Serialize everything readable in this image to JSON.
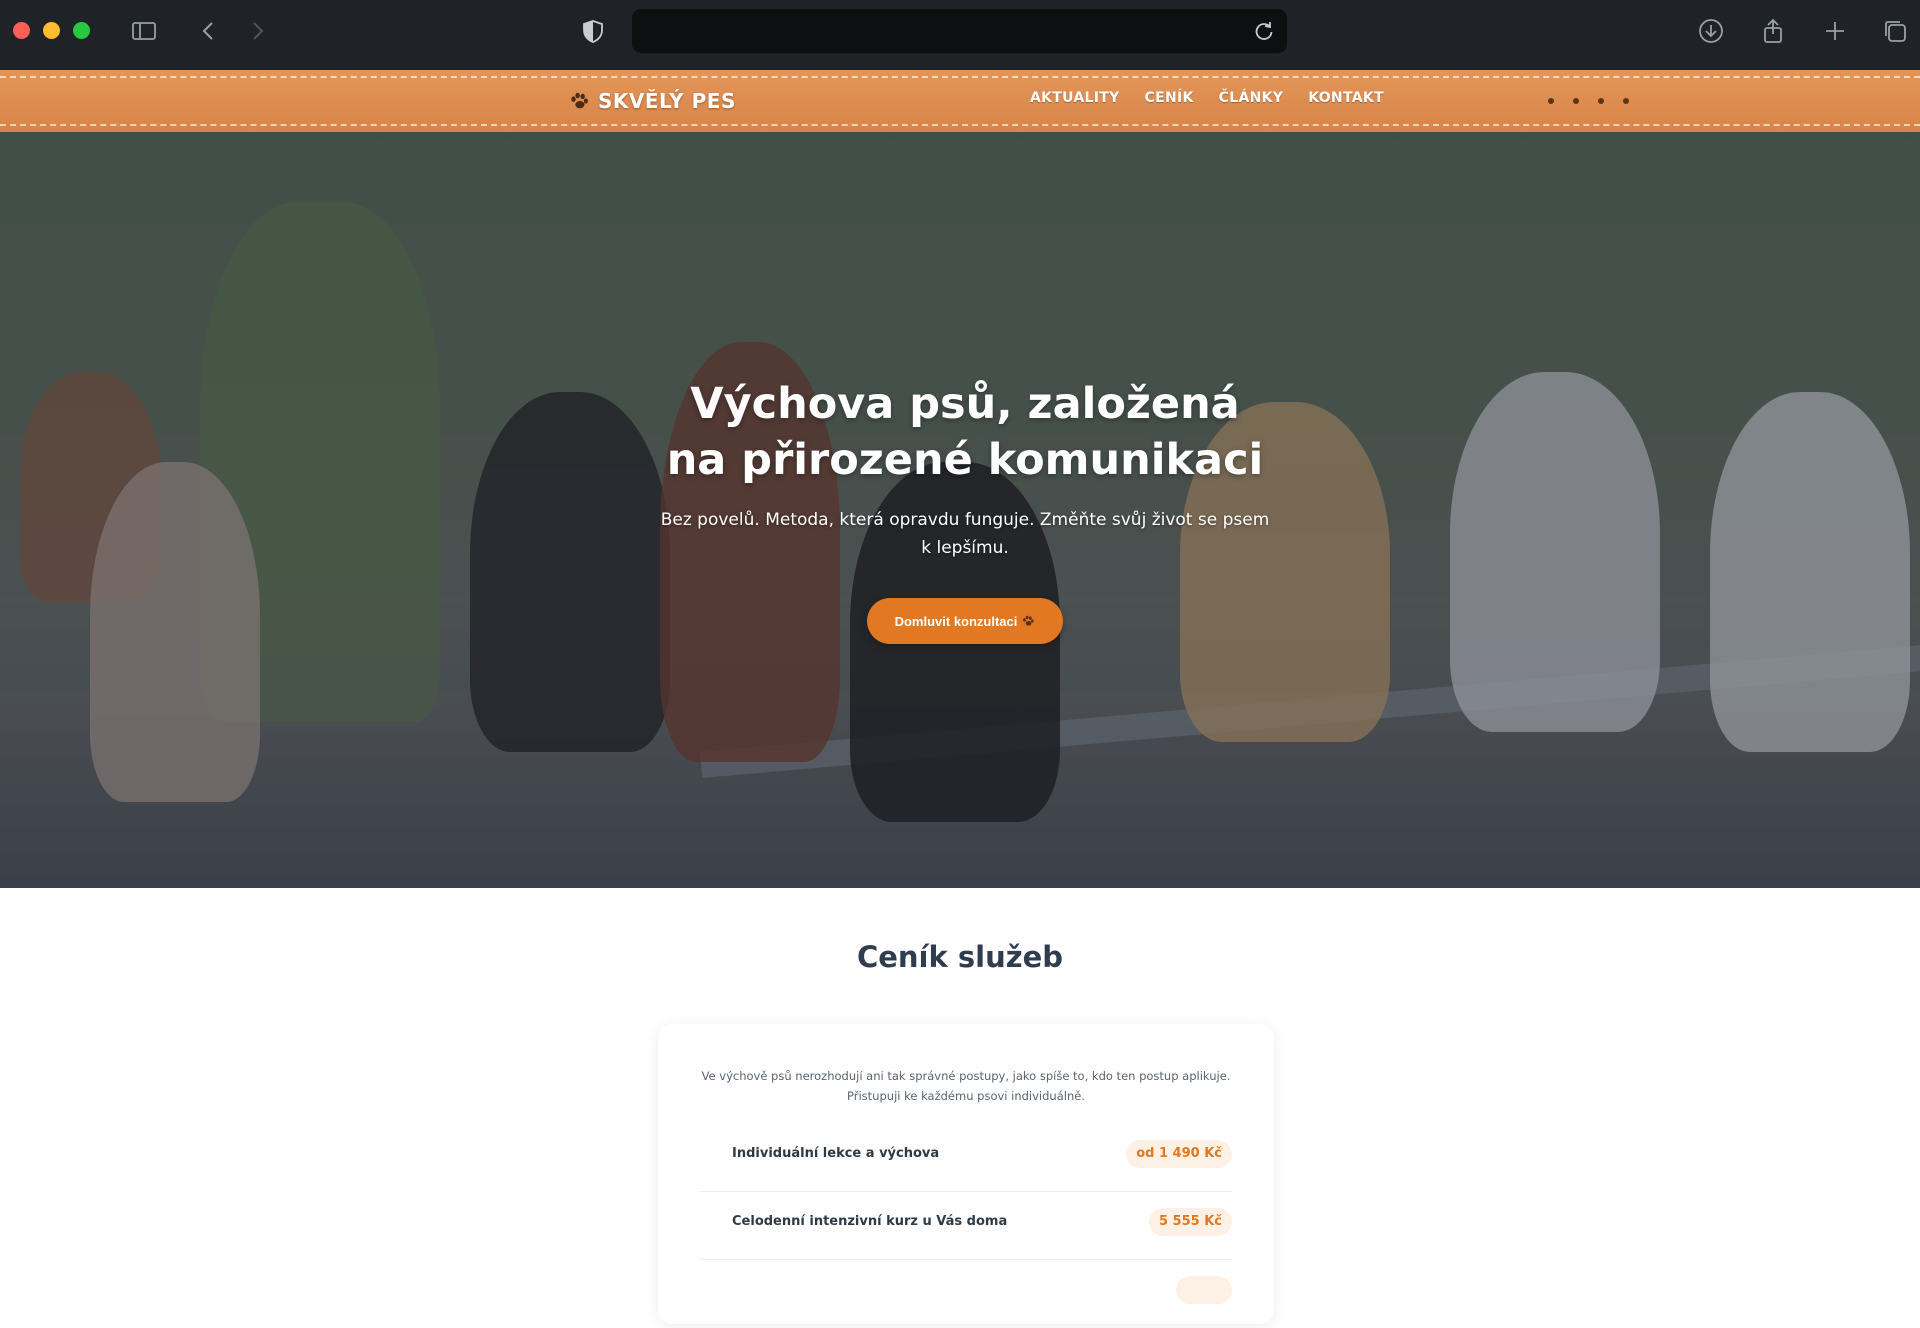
{
  "browser": {
    "url": ""
  },
  "nav": {
    "brand": "SKVĚLÝ PES",
    "items": [
      {
        "label": "AKTUALITY"
      },
      {
        "label": "CENÍK"
      },
      {
        "label": "ČLÁNKY"
      },
      {
        "label": "KONTAKT"
      }
    ]
  },
  "hero": {
    "title": "Výchova psů, založená na přirozené komunikaci",
    "subtitle": "Bez povelů. Metoda, která opravdu funguje. Změňte svůj život se psem k lepšímu.",
    "cta_label": "Domluvit konzultaci"
  },
  "pricing": {
    "title": "Ceník služeb",
    "intro": "Ve výchově psů nerozhodují ani tak správné postupy, jako spíše to, kdo ten postup aplikuje. Přistupuji ke každému psovi individuálně.",
    "rows": [
      {
        "name": "Individuální lekce a výchova",
        "price": "od 1 490 Kč"
      },
      {
        "name": "Celodenní intenzivní kurz u Vás doma",
        "price": "5 555 Kč"
      }
    ]
  },
  "colors": {
    "accent": "#e27821",
    "nav_leather": "#de8c50",
    "heading": "#2f3e4e"
  }
}
